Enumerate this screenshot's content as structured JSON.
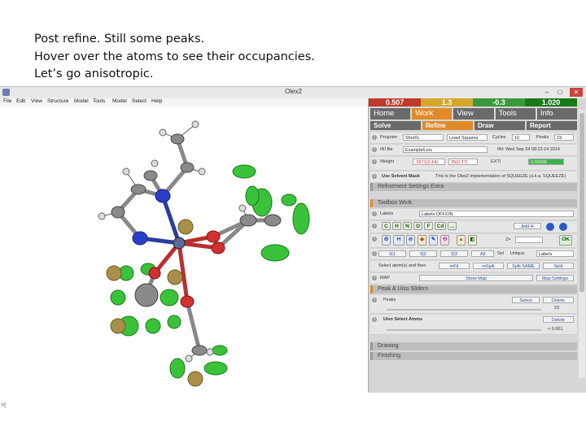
{
  "caption": {
    "line1": "Post refine. Still some peaks.",
    "line2": "Hover over the atoms to see their occupancies.",
    "line3": "Let’s go anisotropic."
  },
  "window": {
    "title": "Olex2",
    "minimize": "–",
    "maximize": "□",
    "close": "✕"
  },
  "menu": [
    "File",
    "Edit",
    "View",
    "Structure",
    "Model",
    "Tools",
    "Model",
    "Select",
    "Help"
  ],
  "viewport": {
    "corner_marker": ">|"
  },
  "stats": {
    "values": [
      "0.507",
      "1.3",
      "-0.3",
      "1.020"
    ],
    "colors": [
      "#c0392b",
      "#d4a72c",
      "#3a9a3a",
      "#1a7a1a"
    ]
  },
  "tabs": [
    "Home",
    "Work",
    "View",
    "Tools",
    "Info"
  ],
  "active_tab": "Work",
  "subtabs": [
    "Solve",
    "Refine",
    "Draw",
    "Report"
  ],
  "active_subtab": "Refine",
  "refine_settings": {
    "program_label": "Program",
    "program_value": "ShelXL",
    "method_value": "Least Squares",
    "cycles_label": "Cycles",
    "cycles_value": "10",
    "peaks_label": "Peaks",
    "peaks_value": "23",
    "ins_label": "INI file",
    "ins_value": "Example6.ins",
    "ins_date": "INI: Wed Sep 24 08:23:14 2014",
    "weight_label": "Weight",
    "weight_value1": ".0571(0.14)",
    "weight_value2": "25(0.27)",
    "extinction_label": "EXTI",
    "extinction_value": "0.00000",
    "solvent_mask_label": "Use Solvent Mask",
    "solvent_mask_note": "This is the Olex2 implementation of SQUEEZE (a.k.a. SQUEEZE)",
    "extra_header": "Refinement Settings Extra"
  },
  "toolbox": {
    "header": "Toolbox Work",
    "labels_label": "Labels",
    "labels_value": "Labels OFF/ON",
    "element_buttons": [
      "C",
      "H",
      "N",
      "O",
      "F",
      "Cd",
      "..."
    ],
    "add_h": "Add H",
    "z_label": "Z=",
    "ok_label": "OK",
    "part_buttons": [
      "0|1",
      "0|2",
      "0|3",
      "All"
    ],
    "sel_label": "Sel",
    "unique_label": "Unique",
    "labels_check": "Labels",
    "select_atoms_label": "Select atom(s) and then",
    "mfit": "mFit",
    "msplit": "mSplit",
    "split_same": "Split SAME",
    "split": "Split",
    "map_label": "MAP",
    "show_map": "Show Map",
    "map_settings": "Map Settings"
  },
  "peaks": {
    "header": "Peak & Uiso Sliders",
    "peaks_label": "Peaks",
    "select": "Select",
    "delete": "Delete",
    "peak_count": "23",
    "uiso_label": "Uiso Select Atoms",
    "uiso_delete": "Delete",
    "uiso_value": "< 0.001"
  },
  "sections": [
    "Drawing",
    "Finishing"
  ]
}
